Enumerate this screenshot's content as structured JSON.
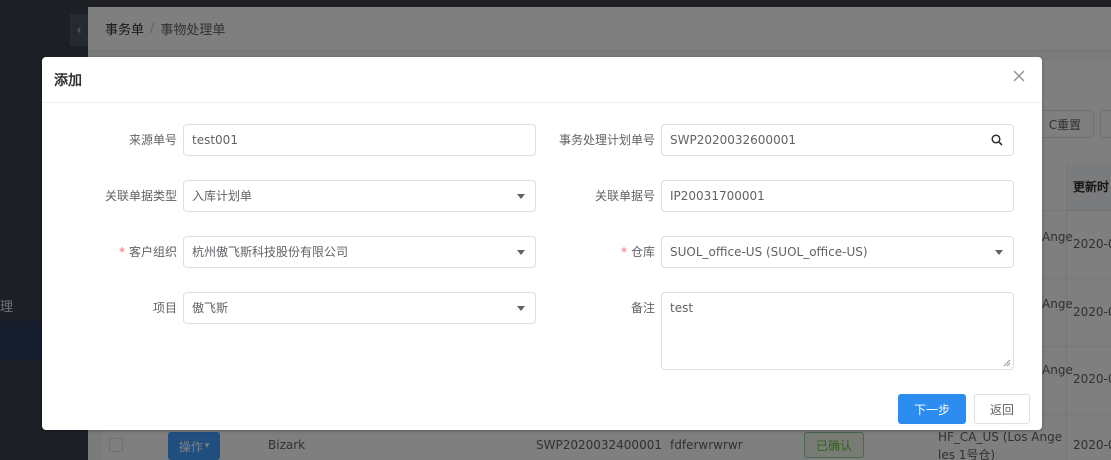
{
  "background": {
    "breadcrumb": {
      "root": "事务单",
      "separator": "/",
      "current": "事物处理单"
    },
    "sidebar": {
      "partial_label": "理"
    },
    "toolbar": {
      "reset_label": "C重置"
    },
    "table": {
      "header_partial": "更新时",
      "rows": [
        {
          "warehouse_partial": "Ange",
          "date_partial": "2020-0"
        },
        {
          "warehouse_partial": "Ange",
          "date_partial": "2020-0"
        },
        {
          "warehouse_partial": "Ange",
          "date_partial": "2020-0"
        }
      ],
      "last_row": {
        "operate_label": "操作",
        "project": "Bizark",
        "plan_no": "SWP2020032400001",
        "remark_line1": "fdferwrwrwr",
        "status": "已确认",
        "warehouse_line1": "HF_CA_US (Los Ange",
        "warehouse_line2": "les 1号仓)",
        "date_partial": "2020-0"
      }
    }
  },
  "dialog": {
    "title": "添加",
    "close_icon": "close-icon",
    "fields": {
      "source_no": {
        "label": "来源单号",
        "value": "test001"
      },
      "plan_no": {
        "label": "事务处理计划单号",
        "value": "SWP2020032600001",
        "icon": "search-icon"
      },
      "related_type": {
        "label": "关联单据类型",
        "value": "入库计划单"
      },
      "related_no": {
        "label": "关联单据号",
        "value": "IP20031700001"
      },
      "customer_org": {
        "label": "客户组织",
        "required": "*",
        "value": "杭州傲飞斯科技股份有限公司"
      },
      "warehouse": {
        "label": "仓库",
        "required": "*",
        "value": "SUOL_office-US (SUOL_office-US)"
      },
      "project": {
        "label": "项目",
        "value": "傲飞斯"
      },
      "remark": {
        "label": "备注",
        "value": "test"
      }
    },
    "buttons": {
      "next": "下一步",
      "back": "返回"
    }
  },
  "colors": {
    "primary": "#2d8cf0",
    "required": "#f56c6c",
    "overlay": "rgba(0,0,0,0.5)"
  }
}
